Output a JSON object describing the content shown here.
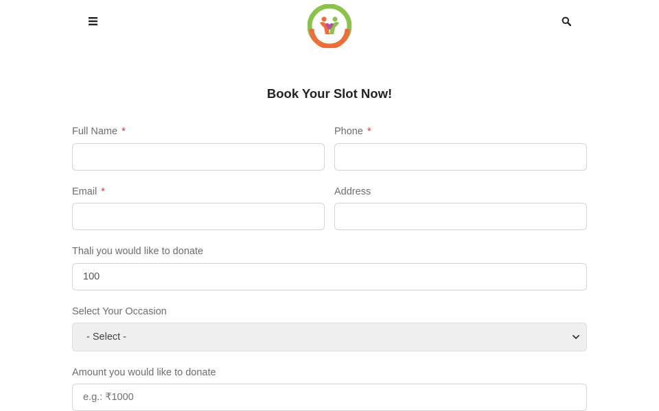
{
  "header": {
    "menu_icon": "hamburger-icon",
    "search_icon": "search-icon",
    "logo_icon": "childcare-trust-logo"
  },
  "form": {
    "title": "Book Your Slot Now!",
    "required_marker": "*",
    "full_name": {
      "label": "Full Name",
      "value": ""
    },
    "phone": {
      "label": "Phone",
      "value": ""
    },
    "email": {
      "label": "Email",
      "value": ""
    },
    "address": {
      "label": "Address",
      "value": ""
    },
    "thali": {
      "label": "Thali you would like to donate",
      "value": "100"
    },
    "occasion": {
      "label": "Select Your Occasion",
      "selected": "- Select -"
    },
    "amount": {
      "label": "Amount you would like to donate",
      "placeholder": "e.g.: ₹1000",
      "value": ""
    }
  },
  "colors": {
    "required": "#d63638",
    "label": "#6d6d6d",
    "border": "#d4d4d4",
    "select_bg": "#efefef",
    "logo_green": "#8bc34a",
    "logo_orange": "#f26b3a"
  }
}
